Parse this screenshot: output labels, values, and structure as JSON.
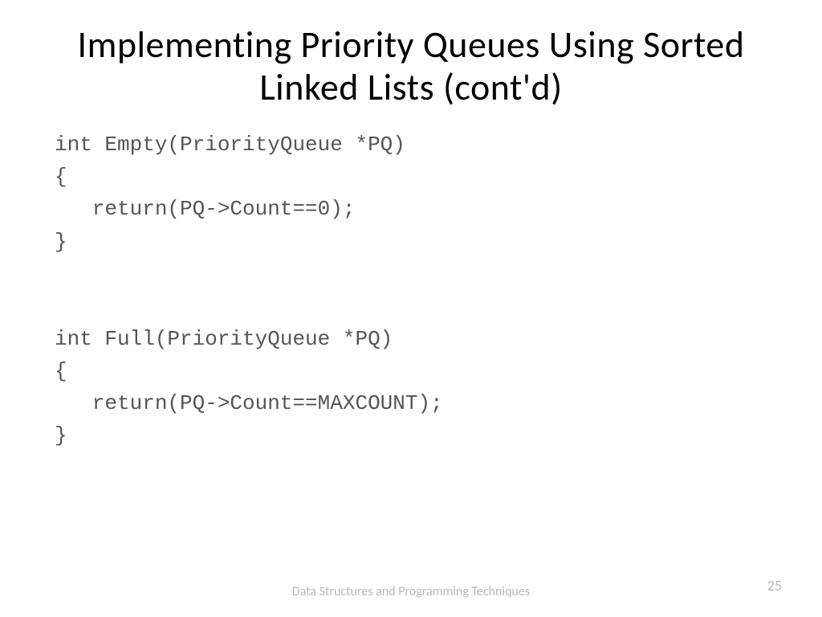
{
  "title": "Implementing Priority Queues Using Sorted Linked Lists (cont'd)",
  "code": "int Empty(PriorityQueue *PQ)\n{\n   return(PQ->Count==0);\n}\n\n\nint Full(PriorityQueue *PQ)\n{\n   return(PQ->Count==MAXCOUNT);\n}",
  "footer": "Data Structures and Programming\nTechniques",
  "page_number": "25"
}
